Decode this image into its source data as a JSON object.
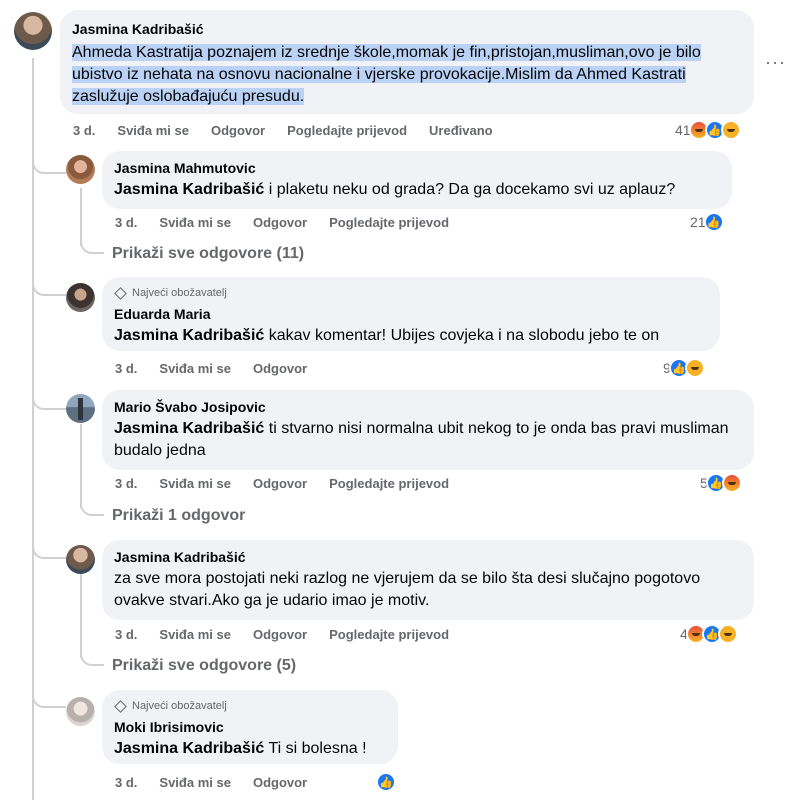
{
  "comments": [
    {
      "author": "Jasmina Kadribašić",
      "text": "Ahmeda Kastratija poznajem iz srednje škole,momak je fin,pristojan,musliman,ovo je bilo ubistvo iz nehata na osnovu nacionalne i vjerske provokacije.Mislim da Ahmed Kastrati zaslužuje oslobađajuću presudu.",
      "time": "3 d.",
      "like": "Sviđa mi se",
      "reply": "Odgovor",
      "translate": "Pogledajte prijevod",
      "edited": "Uređivano",
      "reaction_count": "41",
      "reactions": [
        "angry-icon",
        "like-icon",
        "haha-icon"
      ]
    },
    {
      "author": "Jasmina Mahmutovic",
      "mention": "Jasmina Kadribašić",
      "text": " i plaketu neku od grada? Da ga docekamo svi uz aplauz?",
      "time": "3 d.",
      "like": "Sviđa mi se",
      "reply": "Odgovor",
      "translate": "Pogledajte prijevod",
      "reaction_count": "21",
      "reactions": [
        "like-icon"
      ],
      "more_replies": "Prikaži sve odgovore (11)"
    },
    {
      "badge": "Najveći obožavatelj",
      "author": "Eduarda Maria",
      "mention": "Jasmina Kadribašić",
      "text": " kakav komentar! Ubijes covjeka i na slobodu jebo te on",
      "time": "3 d.",
      "like": "Sviđa mi se",
      "reply": "Odgovor",
      "reaction_count": "9",
      "reactions": [
        "like-icon",
        "haha-icon"
      ]
    },
    {
      "author": "Mario Švabo Josipovic",
      "mention": "Jasmina Kadribašić",
      "text": " ti stvarno nisi normalna ubit nekog to je onda bas pravi musliman budalo jedna",
      "time": "3 d.",
      "like": "Sviđa mi se",
      "reply": "Odgovor",
      "translate": "Pogledajte prijevod",
      "reaction_count": "5",
      "reactions": [
        "like-icon",
        "angry-icon"
      ],
      "more_replies": "Prikaži 1 odgovor"
    },
    {
      "author": "Jasmina Kadribašić",
      "text": "za sve mora postojati neki razlog ne vjerujem da se bilo šta desi slučajno pogotovo ovakve stvari.Ako ga je udario imao je motiv.",
      "time": "3 d.",
      "like": "Sviđa mi se",
      "reply": "Odgovor",
      "translate": "Pogledajte prijevod",
      "reaction_count": "4",
      "reactions": [
        "angry-icon",
        "like-icon",
        "haha-icon"
      ],
      "more_replies": "Prikaži sve odgovore (5)"
    },
    {
      "badge": "Najveći obožavatelj",
      "author": "Moki Ibrisimovic",
      "mention": "Jasmina Kadribašić",
      "text": " Ti si bolesna !",
      "time": "3 d.",
      "like": "Sviđa mi se",
      "reply": "Odgovor",
      "reactions": [
        "like-icon"
      ]
    }
  ],
  "more_options": "···"
}
